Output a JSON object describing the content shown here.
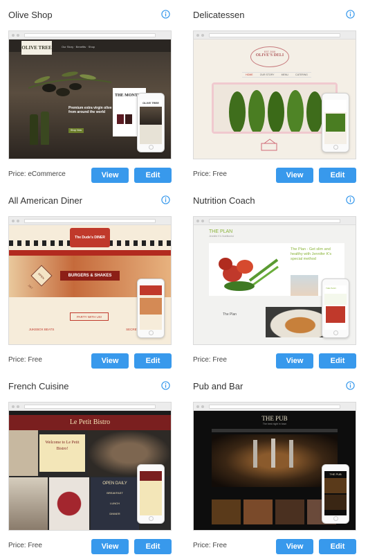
{
  "info_icon": "info-circle-icon",
  "accent": "#3899ec",
  "price_label": "Price:",
  "view_label": "View",
  "edit_label": "Edit",
  "templates": [
    {
      "title": "Olive Shop",
      "price": "eCommerce",
      "preview": {
        "logo": "OLIVE TREE",
        "tagline": "Premium extra virgin olive oils from around the world",
        "button": "Shop Now",
        "promo": "THE MONTH",
        "phone_logo": "OLIVE TREE"
      }
    },
    {
      "title": "Delicatessen",
      "price": "Free",
      "preview": {
        "logo": "OLIVE'S DELI",
        "est": "EST. 2008",
        "nav": [
          "HOME",
          "OUR STORY",
          "MENU",
          "CATERING"
        ]
      }
    },
    {
      "title": "All American Diner",
      "price": "Free",
      "preview": {
        "logo": "The Dude's DINER",
        "banner": "BURGERS & SHAKES",
        "open": "OPEN 24/7",
        "party": "PARTY WITH US!",
        "jukebox": "JUKEBOX BEATS",
        "secret": "SECRET CHEF"
      }
    },
    {
      "title": "Nutrition Coach",
      "price": "Free",
      "preview": {
        "logo": "THE PLAN",
        "sub": "Jennifer K's Nutritionist",
        "headline": "The Plan - Get slim and healthy with Jennifer K's special method",
        "section": "The Plan"
      }
    },
    {
      "title": "French Cuisine",
      "price": "Free",
      "preview": {
        "logo": "Le Petit Bistro",
        "welcome": "Welcome to Le Petit Bistro!",
        "open": "OPEN DAILY",
        "meals": [
          "BREAKFAST",
          "LUNCH",
          "DINNER"
        ]
      }
    },
    {
      "title": "Pub and Bar",
      "price": "Free",
      "preview": {
        "logo": "THE PUB",
        "sub": "The best night in town"
      }
    }
  ]
}
